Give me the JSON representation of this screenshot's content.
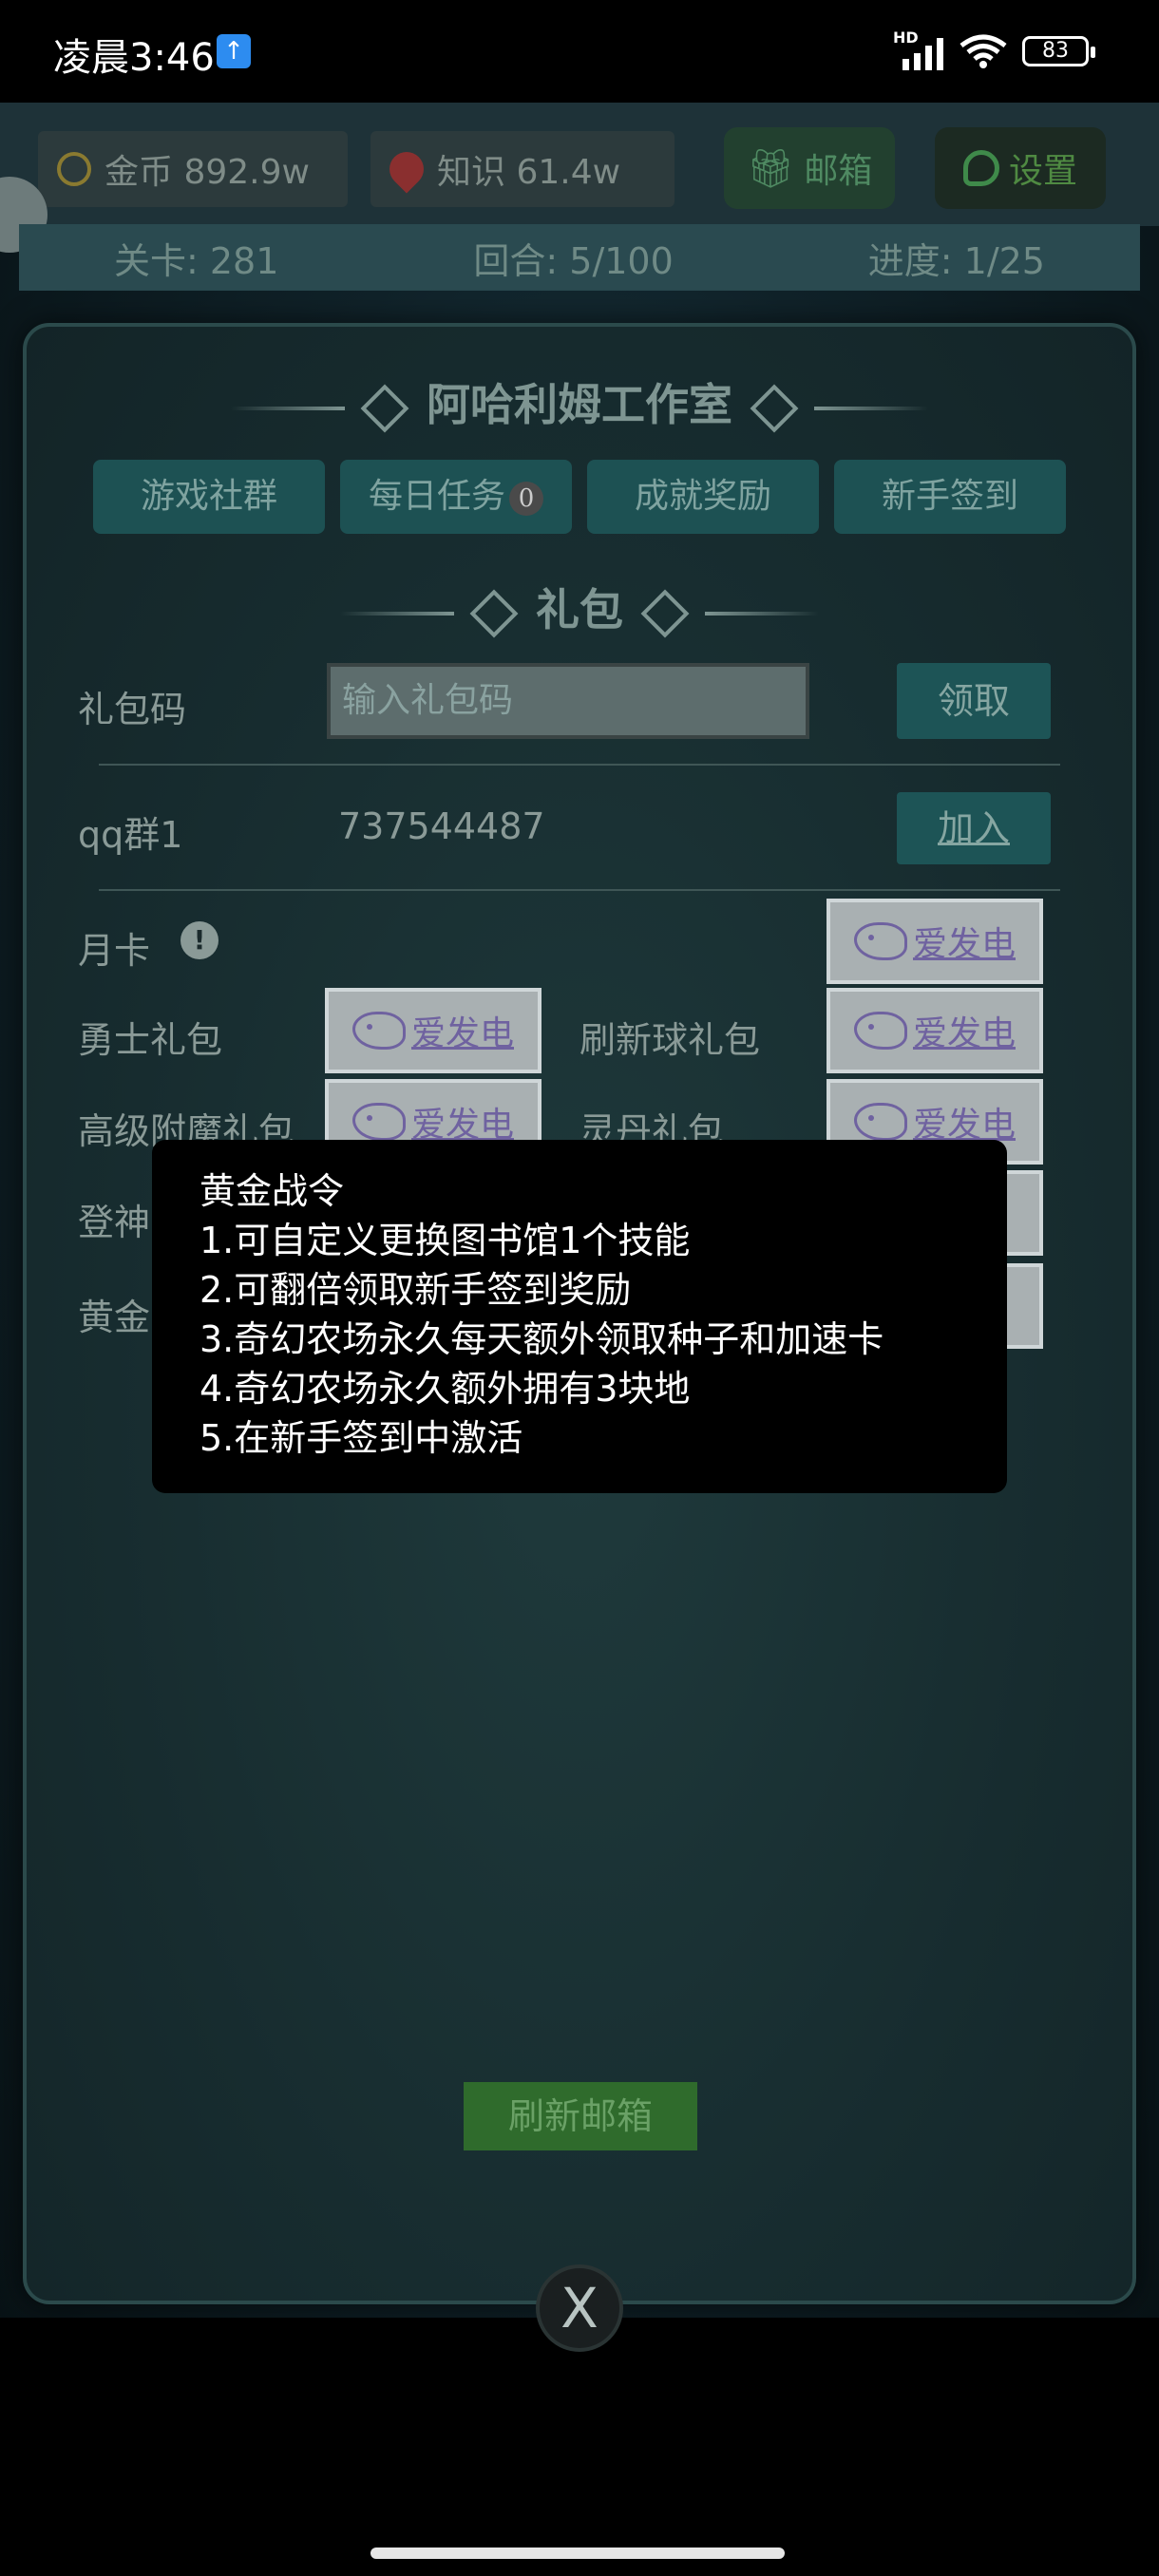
{
  "status_bar": {
    "time": "凌晨3:46",
    "network_badge": "HD",
    "battery": "83"
  },
  "resources": {
    "gold": "金币 892.9w",
    "knowledge": "知识 61.4w"
  },
  "top_buttons": {
    "mail": "邮箱",
    "settings": "设置"
  },
  "progress": {
    "level": "关卡: 281",
    "round": "回合: 5/100",
    "progress": "进度: 1/25"
  },
  "dialog": {
    "title": "阿哈利姆工作室",
    "tabs": [
      "游戏社群",
      "每日任务",
      "成就奖励",
      "新手签到"
    ],
    "daily_badge": "0",
    "gift_heading": "礼包",
    "gift_code_label": "礼包码",
    "gift_code_placeholder": "输入礼包码",
    "claim_button": "领取",
    "qq_label": "qq群1",
    "qq_number": "737544487",
    "join_button": "加入",
    "rows": {
      "monthly": "月卡",
      "warrior": "勇士礼包",
      "refresh_ball": "刷新球礼包",
      "enchant": "高级附魔礼包",
      "spirit_pill": "灵丹礼包",
      "login_partial": "登神",
      "gold_partial": "黄金"
    },
    "afd_label": "爱发电",
    "refresh_mail": "刷新邮箱",
    "close": "X"
  },
  "tooltip": {
    "title": "黄金战令",
    "lines": [
      "1.可自定义更换图书馆1个技能",
      "2.可翻倍领取新手签到奖励",
      "3.奇幻农场永久每天额外领取种子和加速卡",
      "4.奇幻农场永久额外拥有3块地",
      "5.在新手签到中激活"
    ]
  }
}
